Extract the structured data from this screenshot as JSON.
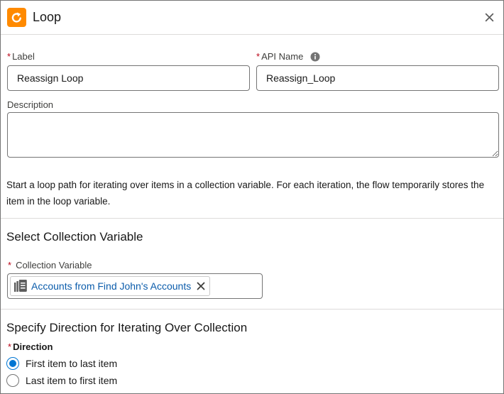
{
  "header": {
    "title": "Loop",
    "icon": "loop-icon",
    "icon_color": "#ff8a00",
    "close_icon": "close-icon"
  },
  "label_field": {
    "required_mark": "*",
    "label": "Label",
    "value": "Reassign Loop"
  },
  "api_name_field": {
    "required_mark": "*",
    "label": "API Name",
    "value": "Reassign_Loop",
    "info_icon": "info-icon"
  },
  "description_field": {
    "label": "Description",
    "value": ""
  },
  "help_text": "Start a loop path for iterating over items in a collection variable. For each iteration, the flow temporarily stores the item in the loop variable.",
  "collection_section": {
    "title": "Select Collection Variable",
    "required_mark": "*",
    "label": "Collection Variable",
    "selected": "Accounts from Find John's Accounts",
    "pill_icon": "collection-icon",
    "remove_icon": "close-icon"
  },
  "direction_section": {
    "title": "Specify Direction for Iterating Over Collection",
    "required_mark": "*",
    "label": "Direction",
    "options": [
      {
        "label": "First item to last item",
        "checked": true
      },
      {
        "label": "Last item to first item",
        "checked": false
      }
    ]
  },
  "colors": {
    "accent": "#0176d3",
    "link": "#0b5cab",
    "required": "#ba0517"
  }
}
